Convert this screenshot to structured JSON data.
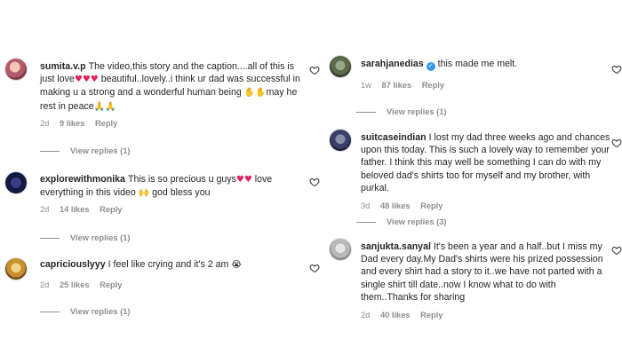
{
  "comments_left": [
    {
      "username": "sumita.v.p",
      "segments": [
        "The video,this story and the caption....all of this is just love",
        " beautiful..lovely..i think ur dad was successful in making u a strong and a wonderful human being ",
        "may he rest in peace"
      ],
      "emojis": [
        "♥♥♥",
        "✋✋",
        "🙏🙏"
      ],
      "age": "2d",
      "likes": "9 likes",
      "reply": "Reply",
      "view_replies": "View replies (1)"
    },
    {
      "username": "explorewithmonika",
      "segments": [
        "This is so precious u guys",
        " love everything in this video ",
        " god bless you"
      ],
      "emojis": [
        "♥♥",
        "🙌"
      ],
      "age": "2d",
      "likes": "14 likes",
      "reply": "Reply",
      "view_replies": "View replies (1)"
    },
    {
      "username": "capriciouslyyy",
      "segments": [
        "I feel like crying and it's 2 am "
      ],
      "emojis": [
        "😭"
      ],
      "age": "2d",
      "likes": "25 likes",
      "reply": "Reply",
      "view_replies": "View replies (1)"
    }
  ],
  "comments_right": [
    {
      "username": "sarahjanedias",
      "verified": true,
      "segments": [
        "this made me melt."
      ],
      "age": "1w",
      "likes": "87 likes",
      "reply": "Reply",
      "view_replies": "View replies (1)"
    },
    {
      "username": "suitcaseindian",
      "segments": [
        "I lost my dad three weeks ago and chances upon this today. This is such a lovely way to remember your father. I think this may well be something I can do with my beloved dad's shirts too for myself and my brother, with purkal."
      ],
      "age": "3d",
      "likes": "48 likes",
      "reply": "Reply",
      "view_replies": "View replies (3)"
    },
    {
      "username": "sanjukta.sanyal",
      "segments": [
        "It's been a year and a half..but I miss my Dad every day.My Dad's shirts were his prized possession and every shirt had a story to it..we have not parted with a single shirt till date..now I know what to do with them..Thanks for sharing"
      ],
      "age": "2d",
      "likes": "40 likes",
      "reply": "Reply"
    }
  ],
  "colors": {
    "text": "#262626",
    "muted": "#8e8e8e",
    "verified": "#3897f0",
    "heart_emoji": "#e0245e"
  },
  "icons": {
    "like": "heart-outline-icon",
    "verified": "verified-badge-icon"
  }
}
